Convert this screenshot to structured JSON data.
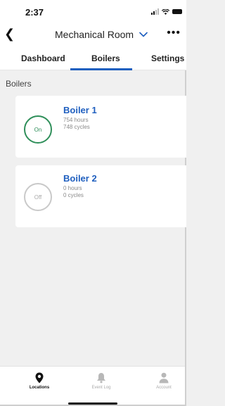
{
  "status": {
    "time": "2:37"
  },
  "nav": {
    "title": "Mechanical Room"
  },
  "tabs": [
    {
      "label": "Dashboard"
    },
    {
      "label": "Boilers",
      "selected": true
    },
    {
      "label": "Settings"
    }
  ],
  "section": {
    "title": "Boilers"
  },
  "boilers": [
    {
      "name": "Boiler 1",
      "state": "On",
      "hours": "754 hours",
      "cycles": "748 cycles"
    },
    {
      "name": "Boiler 2",
      "state": "Off",
      "hours": "0 hours",
      "cycles": "0 cycles"
    }
  ],
  "bottom_nav": [
    {
      "label": "Locations",
      "icon": "location-pin-icon",
      "active": true
    },
    {
      "label": "Event Log",
      "icon": "bell-icon"
    },
    {
      "label": "Account",
      "icon": "person-icon"
    }
  ],
  "colors": {
    "accent": "#1f5fbf",
    "on_state": "#2f8f5a",
    "off_state": "#c9c9c9"
  }
}
